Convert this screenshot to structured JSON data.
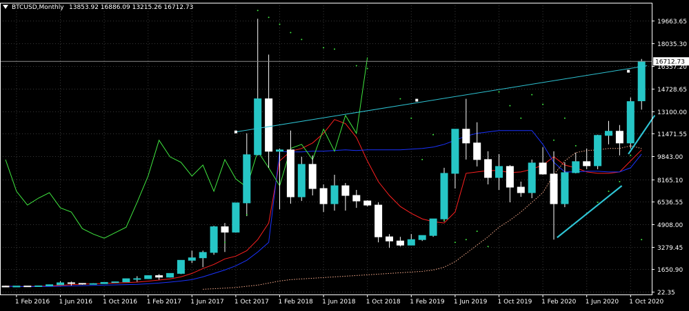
{
  "header": {
    "symbol": "BTCUSD,Monthly",
    "ohlc": "13853.92 16886.09 13215.26 16712.73"
  },
  "colors": {
    "background": "#000000",
    "axis": "#ffffff",
    "grid": "#3a3a3a",
    "bull_body": "#26c6c6",
    "bear_body": "#ffffff",
    "wick": "#ffffff",
    "current_price_box": "#ffffff",
    "trendline": "#2ec4d4",
    "fast_ma": "#ff2020",
    "slow_ma": "#1a33ff",
    "oscillator": "#40e840",
    "dotted_ma": "#ffb090",
    "parabolic_sar": "#40e840"
  },
  "icons": {
    "header_marker": "down-triangle-icon"
  },
  "chart_data": {
    "type": "candlestick",
    "title": "BTCUSD,Monthly",
    "xlabel": "",
    "ylabel": "",
    "price_scale": {
      "ticks": [
        22.35,
        1650.9,
        3279.45,
        4908.0,
        6536.55,
        8165.1,
        9843.0,
        11471.55,
        13100.0,
        14728.65,
        16357.2,
        18035.3,
        19663.65
      ],
      "labels": [
        "22.35",
        "1650.90",
        "3279.45",
        "4908.00",
        "6536.55",
        "8165.10",
        "9843.00",
        "11471.55",
        "13100.00",
        "14728.65",
        "16357.20",
        "18035.30",
        "19663.65"
      ]
    },
    "time_axis": {
      "labels": [
        "1 Feb 2016",
        "1 Jun 2016",
        "1 Oct 2016",
        "1 Feb 2017",
        "1 Jun 2017",
        "1 Oct 2017",
        "1 Feb 2018",
        "1 Jun 2018",
        "1 Oct 2018",
        "1 Feb 2019",
        "1 Jun 2019",
        "1 Oct 2019",
        "1 Feb 2020",
        "1 Jun 2020",
        "1 Oct 2020"
      ],
      "start_month": "2016-01",
      "label_every_months": 4,
      "label_start_index": 1
    },
    "current_price": {
      "value": 16712.73,
      "label": "16712.73"
    },
    "grid": true,
    "candles": [
      {
        "o": 430,
        "h": 460,
        "l": 360,
        "c": 370
      },
      {
        "o": 370,
        "h": 440,
        "l": 360,
        "c": 435
      },
      {
        "o": 435,
        "h": 440,
        "l": 400,
        "c": 415
      },
      {
        "o": 415,
        "h": 470,
        "l": 410,
        "c": 448
      },
      {
        "o": 448,
        "h": 550,
        "l": 440,
        "c": 530
      },
      {
        "o": 530,
        "h": 780,
        "l": 520,
        "c": 670
      },
      {
        "o": 670,
        "h": 760,
        "l": 470,
        "c": 625
      },
      {
        "o": 625,
        "h": 630,
        "l": 530,
        "c": 575
      },
      {
        "o": 575,
        "h": 640,
        "l": 570,
        "c": 610
      },
      {
        "o": 610,
        "h": 720,
        "l": 600,
        "c": 700
      },
      {
        "o": 700,
        "h": 750,
        "l": 690,
        "c": 740
      },
      {
        "o": 740,
        "h": 980,
        "l": 730,
        "c": 965
      },
      {
        "o": 965,
        "h": 1150,
        "l": 750,
        "c": 970
      },
      {
        "o": 970,
        "h": 1210,
        "l": 940,
        "c": 1190
      },
      {
        "o": 1190,
        "h": 1300,
        "l": 890,
        "c": 1080
      },
      {
        "o": 1080,
        "h": 1350,
        "l": 1050,
        "c": 1350
      },
      {
        "o": 1350,
        "h": 2000,
        "l": 1300,
        "c": 2300
      },
      {
        "o": 2300,
        "h": 3000,
        "l": 2100,
        "c": 2480
      },
      {
        "o": 2480,
        "h": 3000,
        "l": 1800,
        "c": 2870
      },
      {
        "o": 2870,
        "h": 4800,
        "l": 2700,
        "c": 4730
      },
      {
        "o": 4730,
        "h": 5000,
        "l": 2900,
        "c": 4340
      },
      {
        "o": 4340,
        "h": 6400,
        "l": 4300,
        "c": 6460
      },
      {
        "o": 6460,
        "h": 11500,
        "l": 5500,
        "c": 9950
      },
      {
        "o": 9950,
        "h": 19800,
        "l": 9900,
        "c": 14000
      },
      {
        "o": 14000,
        "h": 17200,
        "l": 9000,
        "c": 10200
      },
      {
        "o": 10200,
        "h": 10400,
        "l": 6000,
        "c": 10300
      },
      {
        "o": 10300,
        "h": 11700,
        "l": 6400,
        "c": 6900
      },
      {
        "o": 6900,
        "h": 9800,
        "l": 6600,
        "c": 9250
      },
      {
        "o": 9250,
        "h": 9900,
        "l": 7000,
        "c": 7500
      },
      {
        "o": 7500,
        "h": 7800,
        "l": 5800,
        "c": 6400
      },
      {
        "o": 6400,
        "h": 8500,
        "l": 5900,
        "c": 7700
      },
      {
        "o": 7700,
        "h": 7900,
        "l": 5900,
        "c": 7000
      },
      {
        "o": 7000,
        "h": 7400,
        "l": 6100,
        "c": 6600
      },
      {
        "o": 6600,
        "h": 6650,
        "l": 6200,
        "c": 6300
      },
      {
        "o": 6300,
        "h": 6500,
        "l": 3600,
        "c": 4000
      },
      {
        "o": 4000,
        "h": 4200,
        "l": 3200,
        "c": 3700
      },
      {
        "o": 3700,
        "h": 4000,
        "l": 3300,
        "c": 3400
      },
      {
        "o": 3400,
        "h": 4200,
        "l": 3400,
        "c": 3800
      },
      {
        "o": 3800,
        "h": 4100,
        "l": 3700,
        "c": 4100
      },
      {
        "o": 4100,
        "h": 5300,
        "l": 4000,
        "c": 5300
      },
      {
        "o": 5300,
        "h": 9000,
        "l": 5100,
        "c": 8600
      },
      {
        "o": 8600,
        "h": 9000,
        "l": 7500,
        "c": 11800
      },
      {
        "o": 11800,
        "h": 14000,
        "l": 9600,
        "c": 10800
      },
      {
        "o": 10800,
        "h": 12300,
        "l": 9100,
        "c": 9600
      },
      {
        "o": 9600,
        "h": 10200,
        "l": 7800,
        "c": 8300
      },
      {
        "o": 8300,
        "h": 10000,
        "l": 7400,
        "c": 9100
      },
      {
        "o": 9100,
        "h": 9200,
        "l": 6500,
        "c": 7600
      },
      {
        "o": 7600,
        "h": 8000,
        "l": 6900,
        "c": 7200
      },
      {
        "o": 7200,
        "h": 9600,
        "l": 6800,
        "c": 9350
      },
      {
        "o": 9350,
        "h": 10500,
        "l": 8500,
        "c": 8550
      },
      {
        "o": 8550,
        "h": 10200,
        "l": 3800,
        "c": 6400
      },
      {
        "o": 6400,
        "h": 9400,
        "l": 6150,
        "c": 8650
      },
      {
        "o": 8650,
        "h": 10100,
        "l": 8600,
        "c": 9450
      },
      {
        "o": 9450,
        "h": 10400,
        "l": 8900,
        "c": 9150
      },
      {
        "o": 9150,
        "h": 11400,
        "l": 8900,
        "c": 11350
      },
      {
        "o": 11350,
        "h": 12400,
        "l": 10700,
        "c": 11650
      },
      {
        "o": 11650,
        "h": 12100,
        "l": 9900,
        "c": 10800
      },
      {
        "o": 10800,
        "h": 14100,
        "l": 10400,
        "c": 13800
      },
      {
        "o": 13853.92,
        "h": 16886.09,
        "l": 13215.26,
        "c": 16712.73
      }
    ],
    "series": [
      {
        "key": "fast_ma",
        "style": "solid",
        "values": [
          430,
          400,
          400,
          420,
          440,
          480,
          530,
          570,
          600,
          620,
          650,
          680,
          720,
          790,
          870,
          950,
          1100,
          1350,
          1700,
          2000,
          2400,
          2600,
          3000,
          3800,
          5000,
          9500,
          10200,
          10400,
          10800,
          11500,
          12500,
          12200,
          11200,
          9500,
          8000,
          7000,
          6200,
          5700,
          5300,
          5100,
          5000,
          5800,
          8600,
          8700,
          8800,
          8800,
          8650,
          8700,
          8900,
          9200,
          9800,
          9200,
          9000,
          8700,
          8600,
          8600,
          8700,
          9500,
          10300
        ]
      },
      {
        "key": "slow_ma",
        "style": "solid",
        "values": [
          420,
          400,
          395,
          400,
          410,
          420,
          440,
          460,
          480,
          500,
          520,
          540,
          560,
          600,
          650,
          720,
          800,
          900,
          1100,
          1350,
          1600,
          1900,
          2300,
          2900,
          3600,
          10200,
          10150,
          10150,
          10200,
          10200,
          10250,
          10300,
          10250,
          10300,
          10300,
          10300,
          10300,
          10350,
          10400,
          10500,
          10700,
          11000,
          11300,
          11500,
          11600,
          11700,
          11700,
          11700,
          11700,
          10700,
          9400,
          8700,
          8700,
          8750,
          8750,
          8700,
          8700,
          9000,
          10000
        ]
      },
      {
        "key": "dotted_ma",
        "style": "dotted",
        "values": [
          null,
          null,
          null,
          null,
          null,
          null,
          null,
          null,
          null,
          null,
          null,
          null,
          null,
          null,
          null,
          null,
          null,
          null,
          200,
          240,
          280,
          330,
          420,
          500,
          650,
          800,
          900,
          950,
          1000,
          1050,
          1100,
          1150,
          1200,
          1250,
          1300,
          1350,
          1400,
          1450,
          1500,
          1600,
          1800,
          2200,
          2800,
          3400,
          4000,
          4700,
          5200,
          5800,
          6500,
          7200,
          8500,
          9500,
          10100,
          10250,
          10300,
          10400,
          10400,
          10600,
          10400
        ]
      },
      {
        "key": "oscillator",
        "style": "solid",
        "values": [
          9600,
          7300,
          6300,
          6800,
          7200,
          6100,
          5800,
          4600,
          4200,
          3900,
          4300,
          4700,
          6500,
          8400,
          11000,
          9800,
          9400,
          8400,
          9200,
          7300,
          9600,
          8200,
          7600,
          10200,
          9000,
          7700,
          10400,
          10700,
          9600,
          11800,
          10200,
          12800,
          11500,
          17000
        ]
      },
      {
        "key": "trendline_upper",
        "style": "solid",
        "values": []
      },
      {
        "key": "trendline_lower",
        "style": "solid",
        "values": []
      }
    ],
    "trendlines": [
      {
        "from": {
          "i": 21,
          "v": 11600
        },
        "to": {
          "i": 58.5,
          "v": 16400
        },
        "color": "trendline",
        "width": 1
      },
      {
        "from": {
          "i": 50.3,
          "v": 3950
        },
        "to": {
          "i": 56.2,
          "v": 7700
        },
        "color": "trendline",
        "width": 2.2
      },
      {
        "from": {
          "i": 56.8,
          "v": 10000
        },
        "to": {
          "i": 59.2,
          "v": 12800
        },
        "color": "trendline",
        "width": 2.2
      }
    ],
    "psar": [
      {
        "i": 20,
        "v": 3600
      },
      {
        "i": 22,
        "v": 5600
      },
      {
        "i": 23,
        "v": 20400
      },
      {
        "i": 24,
        "v": 19900
      },
      {
        "i": 25,
        "v": 19400
      },
      {
        "i": 26,
        "v": 18800
      },
      {
        "i": 27,
        "v": 18300
      },
      {
        "i": 29,
        "v": 17700
      },
      {
        "i": 30,
        "v": 17600
      },
      {
        "i": 32,
        "v": 16400
      },
      {
        "i": 33,
        "v": 16200
      },
      {
        "i": 36,
        "v": 14000
      },
      {
        "i": 37,
        "v": 12600
      },
      {
        "i": 38,
        "v": 9600
      },
      {
        "i": 39,
        "v": 11400
      },
      {
        "i": 40,
        "v": 5200
      },
      {
        "i": 41,
        "v": 3600
      },
      {
        "i": 42,
        "v": 3800
      },
      {
        "i": 43,
        "v": 4400
      },
      {
        "i": 44,
        "v": 3300
      },
      {
        "i": 45,
        "v": 14500
      },
      {
        "i": 46,
        "v": 13500
      },
      {
        "i": 47,
        "v": 12600
      },
      {
        "i": 48,
        "v": 14300
      },
      {
        "i": 49,
        "v": 13600
      },
      {
        "i": 50,
        "v": 11000
      },
      {
        "i": 51,
        "v": 12600
      },
      {
        "i": 52,
        "v": 10600
      },
      {
        "i": 53,
        "v": 5700
      },
      {
        "i": 54,
        "v": 6500
      },
      {
        "i": 55,
        "v": 7300
      },
      {
        "i": 56,
        "v": 8000
      },
      {
        "i": 57,
        "v": 9900
      },
      {
        "i": 58,
        "v": 3800
      }
    ],
    "markers": [
      {
        "i": 21,
        "v": 11600
      },
      {
        "i": 37.5,
        "v": 13900
      },
      {
        "i": 56.8,
        "v": 16000
      }
    ]
  }
}
